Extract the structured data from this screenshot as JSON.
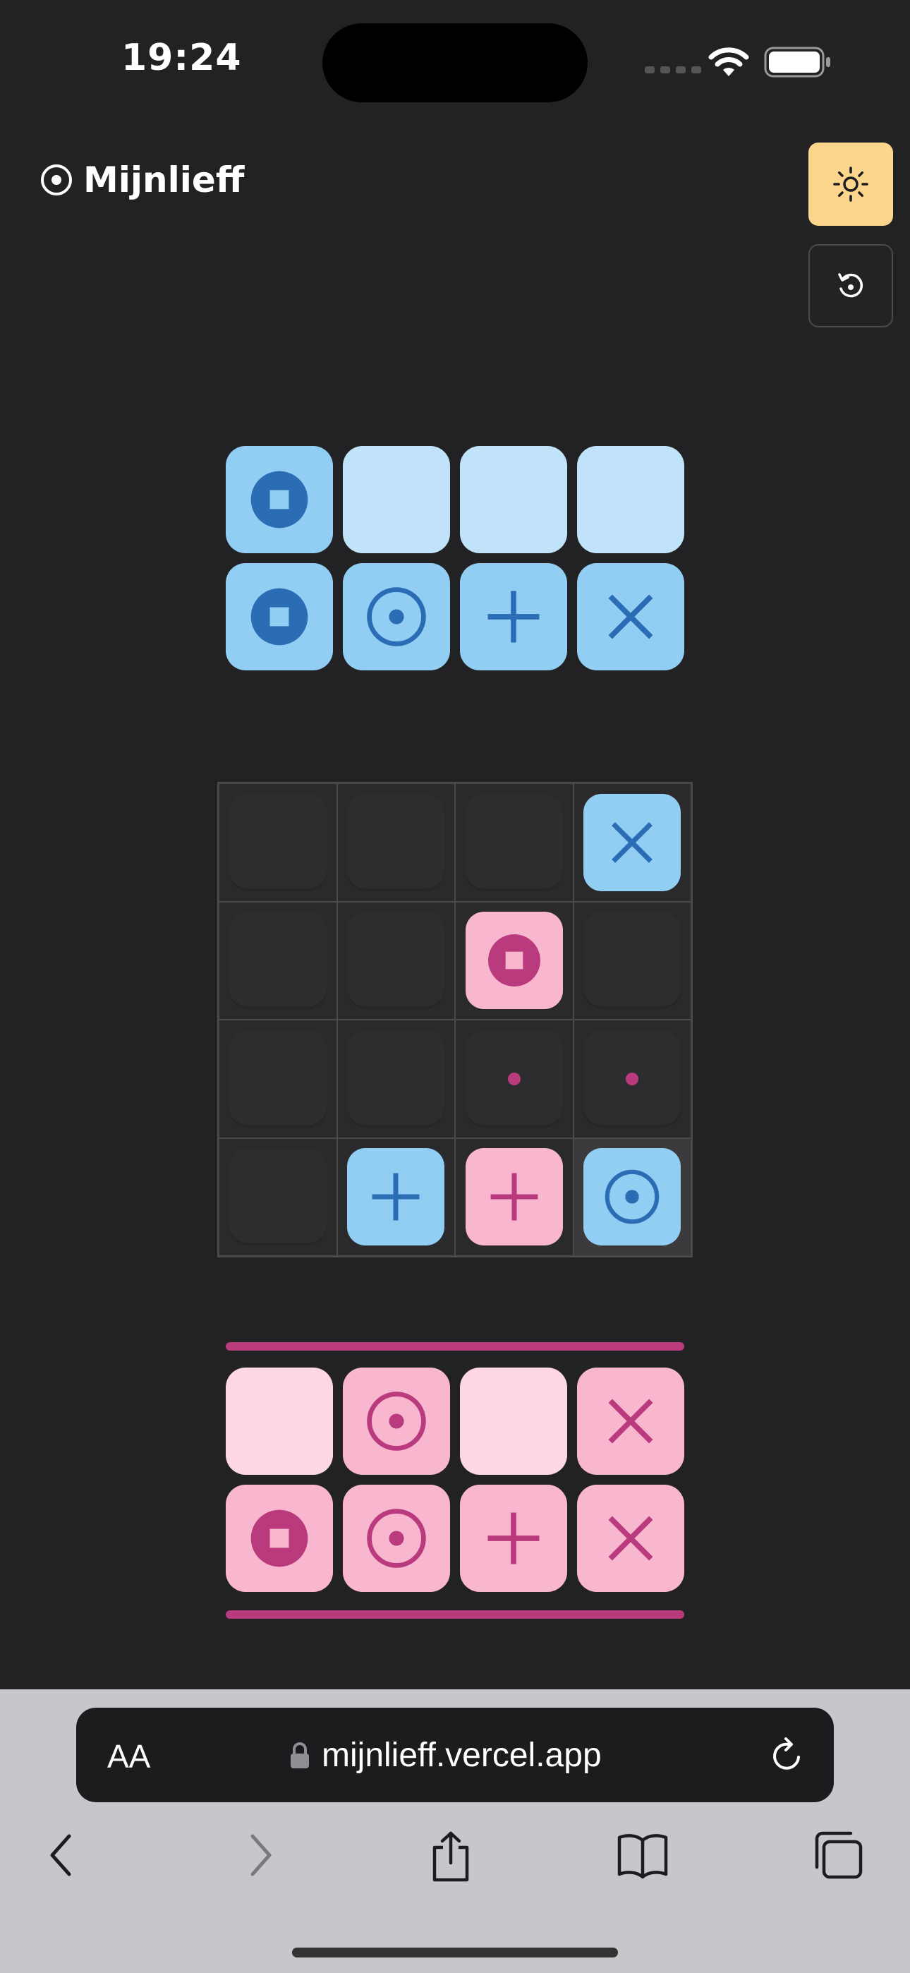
{
  "status": {
    "time": "19:24"
  },
  "header": {
    "title": "Mijnlieff"
  },
  "colors": {
    "blue": "#92cdf4",
    "blue_empty": "#c0e3fa",
    "blue_symbol": "#2b6db5",
    "pink": "#f8b6cf",
    "pink_empty": "#fdd7e5",
    "pink_symbol": "#b93b7d",
    "theme_button": "#fdd68e"
  },
  "opponent_hand": [
    [
      "pusher",
      "empty",
      "empty",
      "empty"
    ],
    [
      "pusher",
      "toplight",
      "straight",
      "diagonal"
    ]
  ],
  "board": [
    [
      "empty",
      "empty",
      "empty",
      "blue:diagonal"
    ],
    [
      "empty",
      "empty",
      "pink:pusher",
      "empty"
    ],
    [
      "empty",
      "empty",
      "hint",
      "hint"
    ],
    [
      "empty",
      "blue:straight",
      "pink:straight",
      "blue:toplight"
    ]
  ],
  "player_hand": [
    [
      "empty",
      "toplight",
      "empty",
      "diagonal"
    ],
    [
      "pusher",
      "toplight",
      "straight",
      "diagonal"
    ]
  ],
  "browser": {
    "text_size": "AA",
    "url": "mijnlieff.vercel.app"
  }
}
